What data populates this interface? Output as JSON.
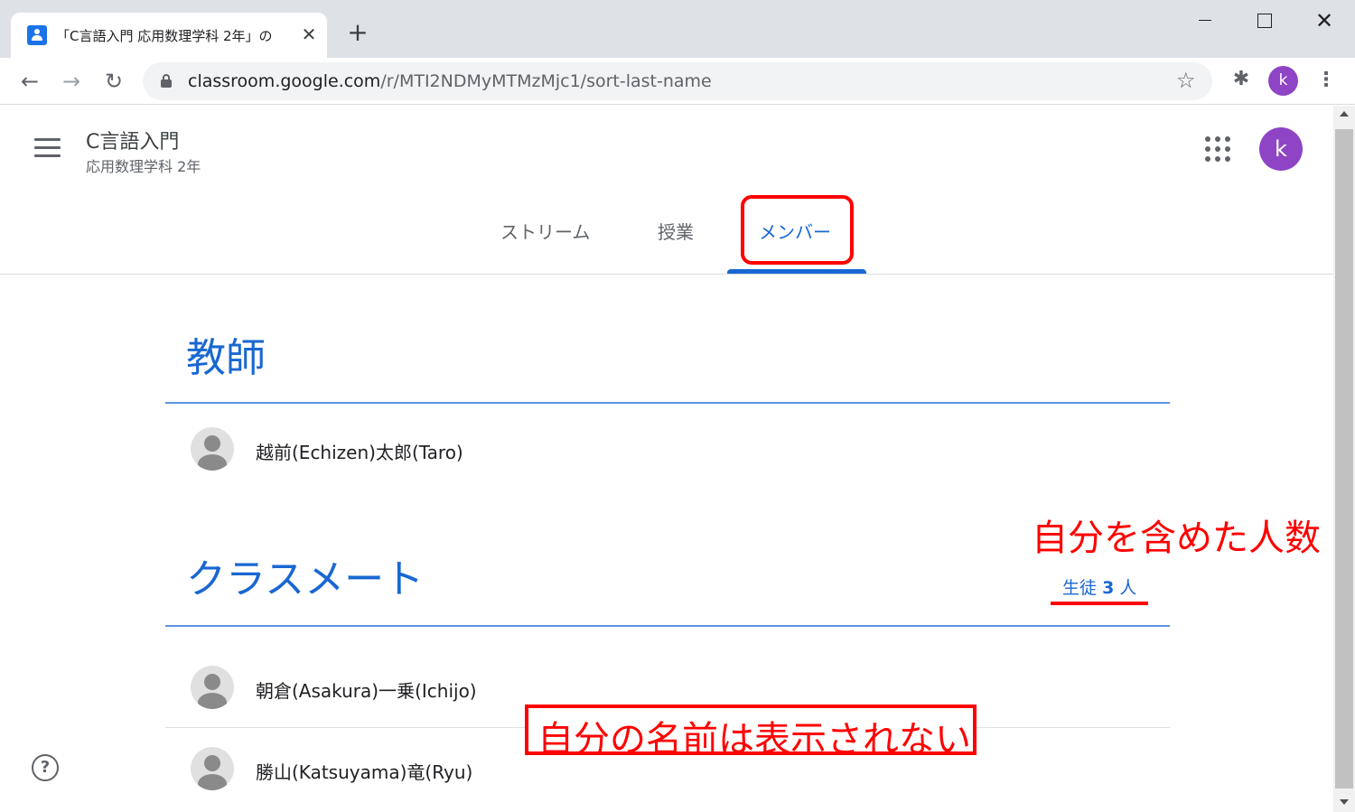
{
  "browser": {
    "tab_title": "「C言語入門 応用数理学科 2年」の",
    "tab_close": "✕",
    "new_tab": "+",
    "url_host": "classroom.google.com",
    "url_path": "/r/MTI2NDMyMTMzMjc1/sort-last-name",
    "profile_initial": "k",
    "back": "←",
    "forward": "→",
    "reload": "↻",
    "star": "☆",
    "extensions": "✱",
    "menu": "⋮",
    "win_close": "✕"
  },
  "header": {
    "class_name": "C言語入門",
    "class_section": "応用数理学科 2年",
    "avatar_initial": "k"
  },
  "tabs": [
    {
      "label": "ストリーム"
    },
    {
      "label": "授業"
    },
    {
      "label": "メンバー",
      "active": true
    }
  ],
  "teachers": {
    "title": "教師",
    "members": [
      {
        "name": "越前(Echizen)太郎(Taro)"
      }
    ]
  },
  "classmates": {
    "title": "クラスメート",
    "count_prefix": "生徒",
    "count_value": "3",
    "count_suffix": "人",
    "members": [
      {
        "name": "朝倉(Asakura)一乗(Ichijo)"
      },
      {
        "name": "勝山(Katsuyama)竜(Ryu)"
      }
    ]
  },
  "help": "?",
  "annotations": {
    "count_note": "自分を含めた人数",
    "self_note": "自分の名前は表示されない",
    "color": "#ff0000"
  },
  "colors": {
    "accent": "#1967d2",
    "avatar": "#8e44c5"
  }
}
